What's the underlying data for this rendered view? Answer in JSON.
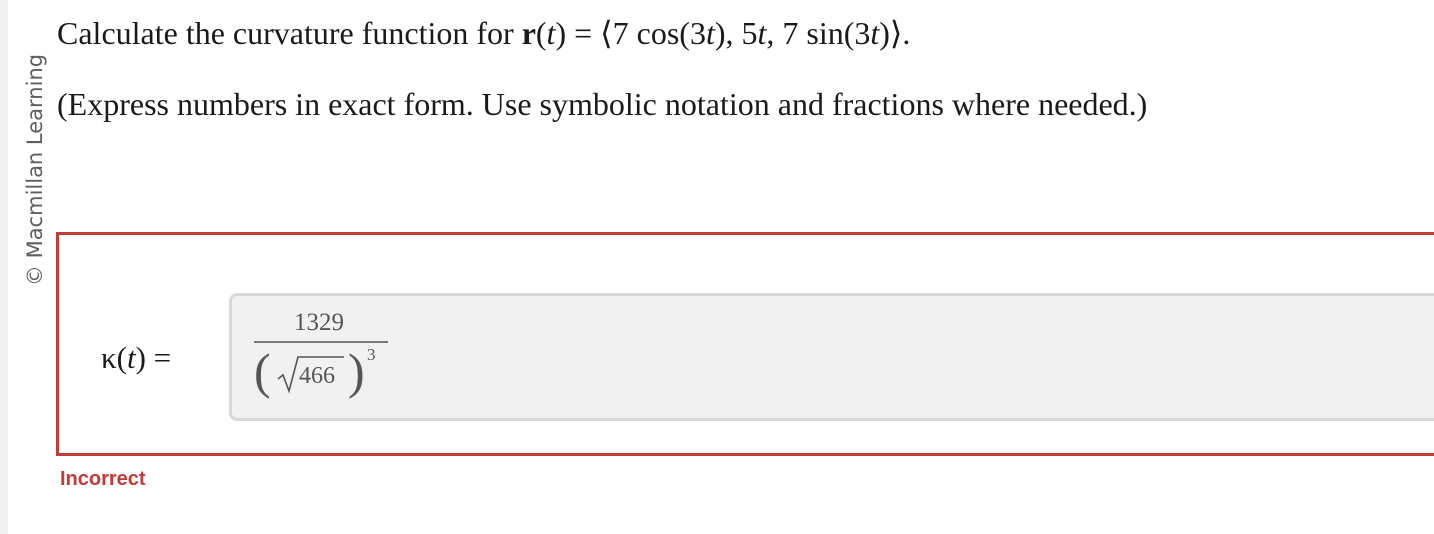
{
  "watermark": "© Macmillan Learning",
  "question": {
    "prefix": "Calculate the curvature function for ",
    "func_name": "r",
    "func_open": "(",
    "func_var": "t",
    "func_close": ") = ⟨7 cos(3",
    "c1_var": "t",
    "c1_close": "), 5",
    "c2_var": "t",
    "c2_close": ", 7 sin(3",
    "c3_var": "t",
    "suffix": ")⟩."
  },
  "instruction": "(Express numbers in exact form. Use symbolic notation and fractions where needed.)",
  "answer": {
    "label_open": "κ(",
    "label_var": "t",
    "label_close": ") =",
    "numerator": "1329",
    "paren_left": "(",
    "radicand": "466",
    "paren_right": ")",
    "exponent": "3"
  },
  "status": {
    "text": "Incorrect",
    "color": "#c13b38"
  },
  "colors": {
    "error_border": "#c13b38",
    "input_bg": "#f1f1f1",
    "input_border": "#d9d9d9"
  }
}
